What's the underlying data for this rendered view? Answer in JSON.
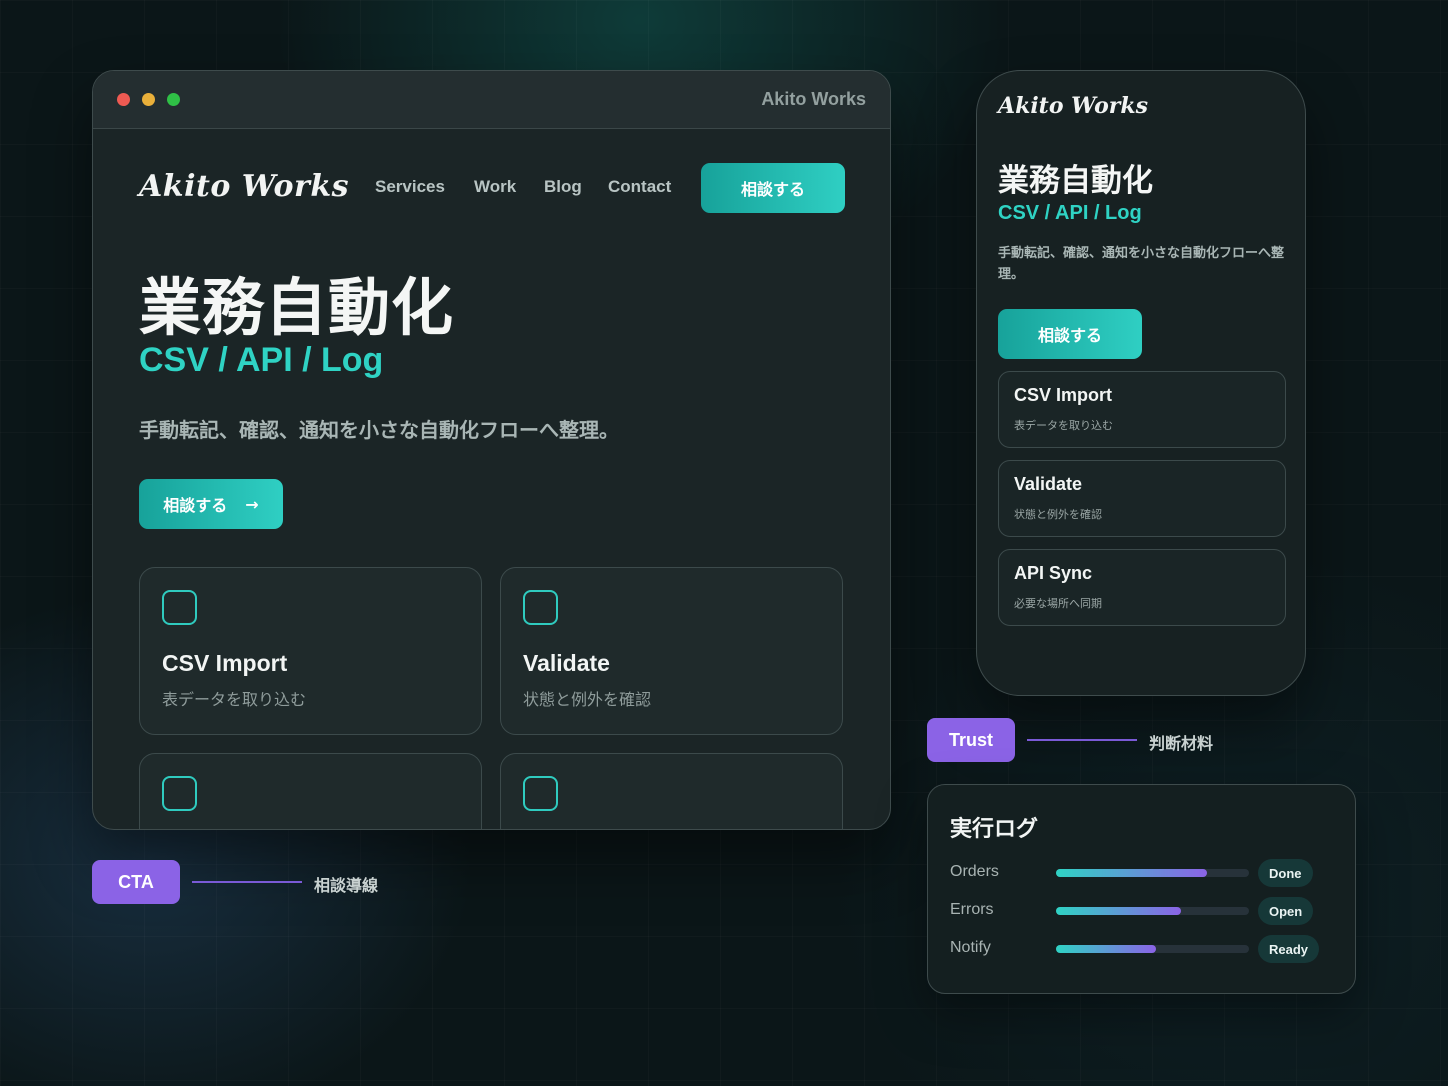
{
  "brand": "Akito Works",
  "desktop": {
    "window_title": "Akito Works",
    "nav": [
      "Services",
      "Work",
      "Blog",
      "Contact"
    ],
    "header_cta": "相談する",
    "hero": {
      "title": "業務自動化",
      "subtitle": "CSV / API / Log",
      "description": "手動転記、確認、通知を小さな自動化フローへ整理。",
      "cta": "相談する",
      "cta_arrow": "→"
    },
    "cards": [
      {
        "title": "CSV Import",
        "desc": "表データを取り込む"
      },
      {
        "title": "Validate",
        "desc": "状態と例外を確認"
      }
    ]
  },
  "mobile": {
    "logo": "Akito Works",
    "title": "業務自動化",
    "subtitle": "CSV / API / Log",
    "description": "手動転記、確認、通知を小さな自動化フローへ整理。",
    "cta": "相談する",
    "cards": [
      {
        "title": "CSV Import",
        "desc": "表データを取り込む"
      },
      {
        "title": "Validate",
        "desc": "状態と例外を確認"
      },
      {
        "title": "API Sync",
        "desc": "必要な場所へ同期"
      }
    ]
  },
  "annotations": {
    "cta": {
      "tag": "CTA",
      "label": "相談導線"
    },
    "trust": {
      "tag": "Trust",
      "label": "判断材料"
    }
  },
  "log": {
    "title": "実行ログ",
    "rows": [
      {
        "label": "Orders",
        "progress": 0.78,
        "status": "Done"
      },
      {
        "label": "Errors",
        "progress": 0.65,
        "status": "Open"
      },
      {
        "label": "Notify",
        "progress": 0.52,
        "status": "Ready"
      }
    ]
  },
  "colors": {
    "accent": "#2fd3c4",
    "accent_dark": "#17a29a",
    "tag_purple": "#8b63e6",
    "background": "#0b1618"
  }
}
